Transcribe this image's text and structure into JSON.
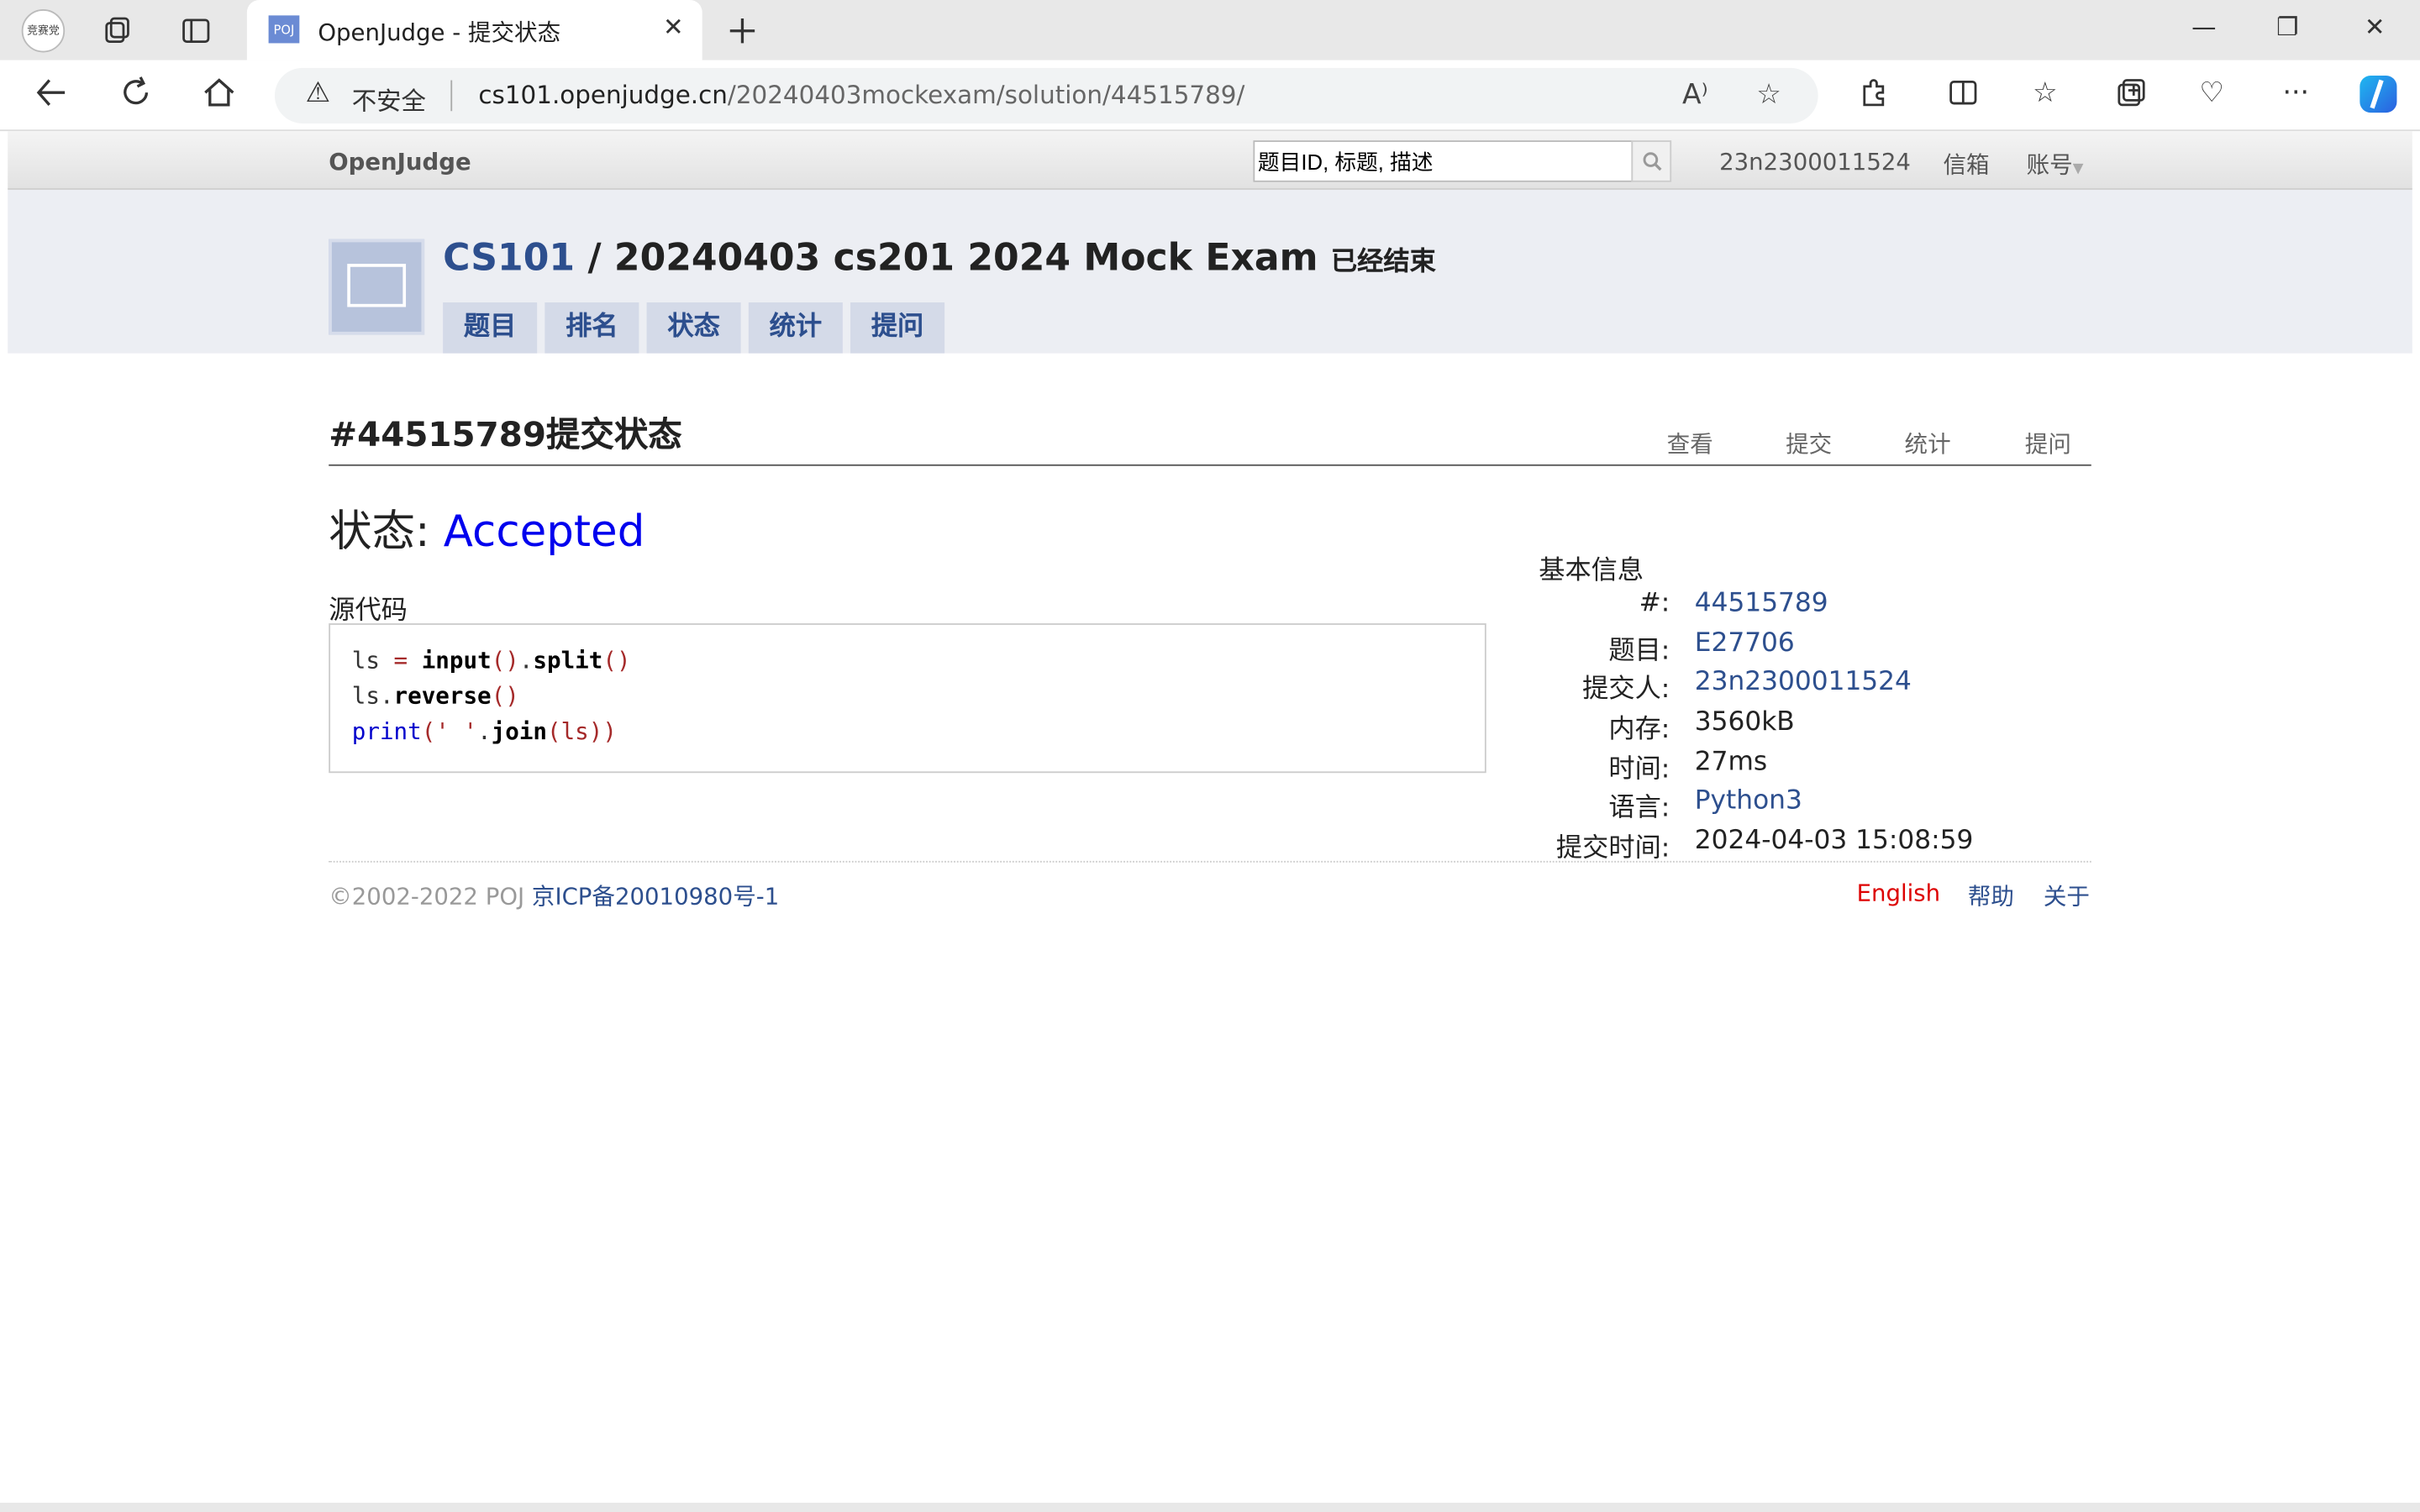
{
  "browser": {
    "profile_label": "竞赛党",
    "tab_favicon": "POJ",
    "tab_title": "OpenJudge - 提交状态",
    "not_secure": "不安全",
    "url_host": "cs101.openjudge.cn",
    "url_path": "/20240403mockexam/solution/44515789/"
  },
  "topnav": {
    "brand": "OpenJudge",
    "search_value": "题目ID, 标题, 描述",
    "username": "23n2300011524",
    "mailbox": "信箱",
    "account": "账号"
  },
  "contest": {
    "group": "CS101",
    "separator": "/",
    "name": "20240403 cs201 2024 Mock Exam",
    "state": "已经结束",
    "tabs": [
      "题目",
      "排名",
      "状态",
      "统计",
      "提问"
    ]
  },
  "page": {
    "title": "#44515789提交状态",
    "links": [
      "查看",
      "提交",
      "统计",
      "提问"
    ],
    "status_label": "状态:",
    "status_value": "Accepted",
    "source_label": "源代码"
  },
  "code": {
    "line1_var": "ls",
    "line1_eq": " = ",
    "line1_input": "input",
    "line1_p1": "()",
    "line1_dot": ".",
    "line1_split": "split",
    "line1_p2": "()",
    "line2_var": "ls",
    "line2_dot": ".",
    "line2_fn": "reverse",
    "line2_p": "()",
    "line3_print": "print",
    "line3_open": "(",
    "line3_str": "' '",
    "line3_dot": ".",
    "line3_join": "join",
    "line3_args": "(ls))"
  },
  "info": {
    "title": "基本信息",
    "rows": [
      {
        "label": "#:",
        "value": "44515789"
      },
      {
        "label": "题目:",
        "value": "E27706"
      },
      {
        "label": "提交人:",
        "value": "23n2300011524"
      },
      {
        "label": "内存:",
        "value": "3560kB"
      },
      {
        "label": "时间:",
        "value": "27ms"
      },
      {
        "label": "语言:",
        "value": "Python3"
      },
      {
        "label": "提交时间:",
        "value": "2024-04-03 15:08:59"
      }
    ]
  },
  "footer": {
    "copyright": "©2002-2022 POJ ",
    "icp": "京ICP备20010980号-1",
    "english": "English",
    "help": "帮助",
    "about": "关于"
  },
  "colors": {
    "link": "#2d4f8e",
    "accepted": "#0000ee",
    "english": "#dd0000"
  }
}
